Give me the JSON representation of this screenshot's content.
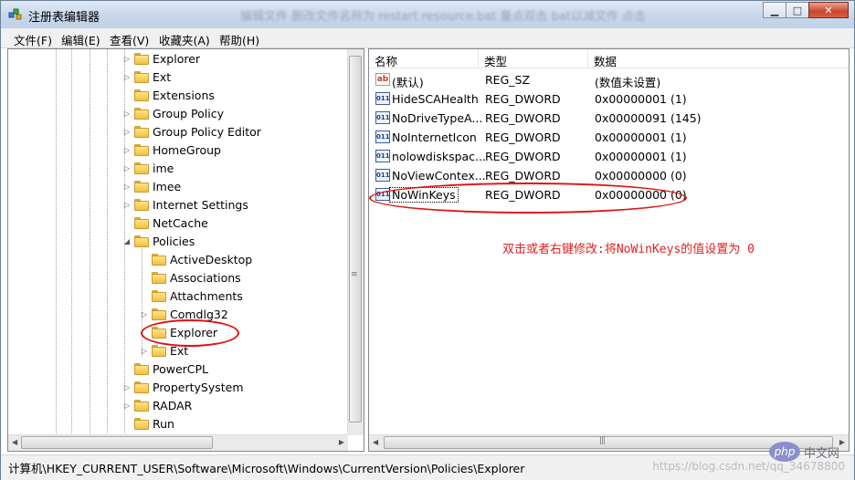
{
  "window": {
    "title": "注册表编辑器",
    "background_title": "编辑文件 删改文件名称为 restart resource.bat 量点双击 bat以减文件 点击"
  },
  "menu": [
    "文件(F)",
    "编辑(E)",
    "查看(V)",
    "收藏夹(A)",
    "帮助(H)"
  ],
  "tree": {
    "items": [
      {
        "label": "Explorer",
        "expand": "closed"
      },
      {
        "label": "Ext",
        "expand": "closed"
      },
      {
        "label": "Extensions",
        "expand": "none"
      },
      {
        "label": "Group Policy",
        "expand": "closed"
      },
      {
        "label": "Group Policy Editor",
        "expand": "closed"
      },
      {
        "label": "HomeGroup",
        "expand": "closed"
      },
      {
        "label": "ime",
        "expand": "closed"
      },
      {
        "label": "Imee",
        "expand": "closed"
      },
      {
        "label": "Internet Settings",
        "expand": "closed"
      },
      {
        "label": "NetCache",
        "expand": "none"
      },
      {
        "label": "Policies",
        "expand": "open"
      },
      {
        "label": "ActiveDesktop",
        "expand": "none"
      },
      {
        "label": "Associations",
        "expand": "none"
      },
      {
        "label": "Attachments",
        "expand": "none"
      },
      {
        "label": "Comdlg32",
        "expand": "closed"
      },
      {
        "label": "Explorer",
        "expand": "none"
      },
      {
        "label": "Ext",
        "expand": "closed"
      },
      {
        "label": "PowerCPL",
        "expand": "none"
      },
      {
        "label": "PropertySystem",
        "expand": "closed"
      },
      {
        "label": "RADAR",
        "expand": "closed"
      },
      {
        "label": "Run",
        "expand": "none"
      }
    ]
  },
  "list": {
    "headers": [
      "名称",
      "类型",
      "数据"
    ],
    "rows": [
      {
        "icon": "ab",
        "name": "(默认)",
        "type": "REG_SZ",
        "data": "(数值未设置)"
      },
      {
        "icon": "011",
        "name": "HideSCAHealth",
        "type": "REG_DWORD",
        "data": "0x00000001 (1)"
      },
      {
        "icon": "011",
        "name": "NoDriveTypeA...",
        "type": "REG_DWORD",
        "data": "0x00000091 (145)"
      },
      {
        "icon": "011",
        "name": "NoInternetIcon",
        "type": "REG_DWORD",
        "data": "0x00000001 (1)"
      },
      {
        "icon": "011",
        "name": "nolowdiskspac...",
        "type": "REG_DWORD",
        "data": "0x00000001 (1)"
      },
      {
        "icon": "011",
        "name": "NoViewContex...",
        "type": "REG_DWORD",
        "data": "0x00000000 (0)"
      },
      {
        "icon": "011",
        "name": "NoWinKeys",
        "type": "REG_DWORD",
        "data": "0x00000000 (0)"
      }
    ]
  },
  "annotation": "双击或者右键修改:将NoWinKeys的值设置为 0",
  "status": "计算机\\HKEY_CURRENT_USER\\Software\\Microsoft\\Windows\\CurrentVersion\\Policies\\Explorer",
  "watermark": {
    "logo": "php",
    "site": "中文网",
    "url": "https://blog.csdn.net/qq_34678800"
  },
  "colors": {
    "annotation": "#e02020",
    "titlebar": "#c9d9ec"
  }
}
